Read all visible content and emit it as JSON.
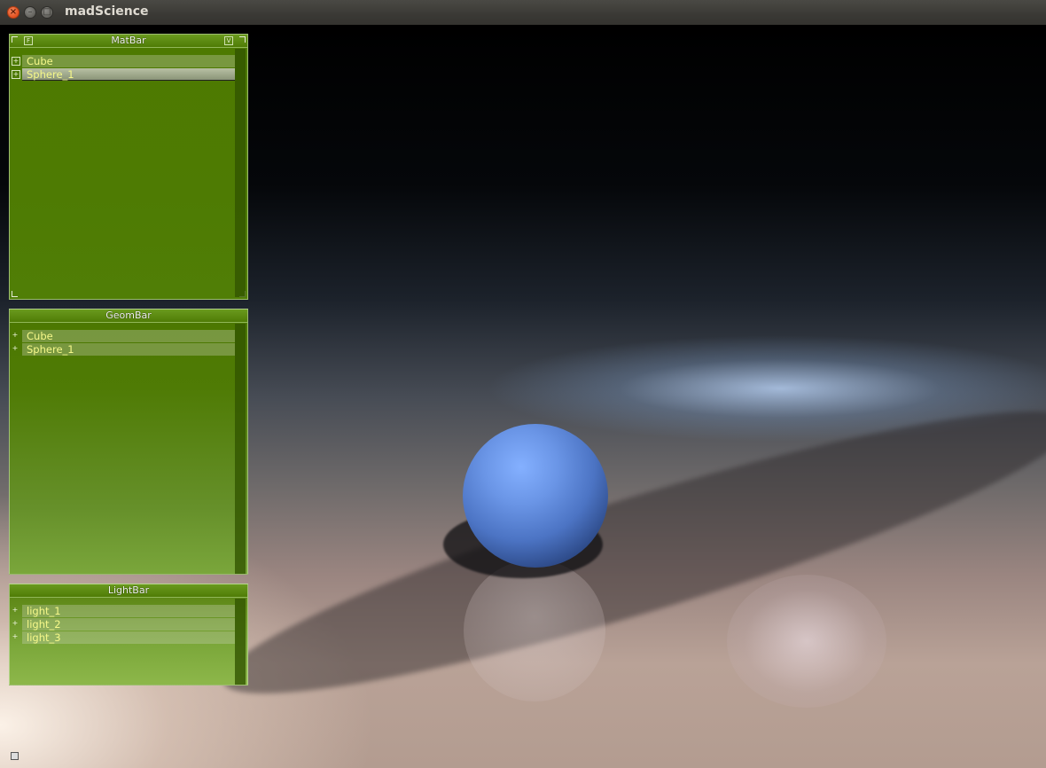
{
  "window": {
    "title": "madScience",
    "buttons": {
      "close": "×",
      "minimize": "–",
      "maximize": "□"
    }
  },
  "colors": {
    "panel_green": "#4e7b03",
    "item_text": "#f6f88a",
    "sphere_blue": "#6a95e6"
  },
  "matbar": {
    "title": "MatBar",
    "icons": {
      "left": "F",
      "right": "V"
    },
    "items": [
      {
        "label": "Cube",
        "toggle": "+",
        "selected": false
      },
      {
        "label": "Sphere_1",
        "toggle": "+",
        "selected": true
      }
    ]
  },
  "geombar": {
    "title": "GeomBar",
    "items": [
      {
        "label": "Cube",
        "toggle": "+"
      },
      {
        "label": "Sphere_1",
        "toggle": "+"
      }
    ]
  },
  "lightbar": {
    "title": "LightBar",
    "items": [
      {
        "label": "light_1",
        "toggle": "+"
      },
      {
        "label": "light_2",
        "toggle": "+"
      },
      {
        "label": "light_3",
        "toggle": "+"
      }
    ]
  }
}
